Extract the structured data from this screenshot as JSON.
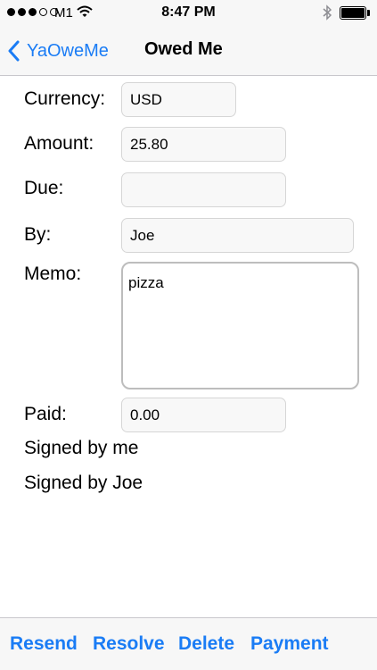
{
  "status_bar": {
    "carrier": "M1",
    "time": "8:47 PM",
    "signal_bars_filled": 3,
    "signal_bars_total": 5,
    "battery_level": 1.0
  },
  "nav": {
    "back_label": "YaOweMe",
    "title": "Owed Me"
  },
  "form": {
    "currency_label": "Currency:",
    "currency_value": "USD",
    "amount_label": "Amount:",
    "amount_value": "25.80",
    "due_label": "Due:",
    "due_value": "",
    "by_label": "By:",
    "by_value": "Joe",
    "memo_label": "Memo:",
    "memo_value": "pizza",
    "paid_label": "Paid:",
    "paid_value": "0.00",
    "signed_me": "Signed by me",
    "signed_other": "Signed by Joe"
  },
  "toolbar": {
    "resend": "Resend",
    "resolve": "Resolve",
    "delete": "Delete",
    "payment": "Payment"
  },
  "colors": {
    "accent": "#1a7cf5",
    "bar_background": "#f7f7f7",
    "input_background": "#f8f8f8"
  }
}
